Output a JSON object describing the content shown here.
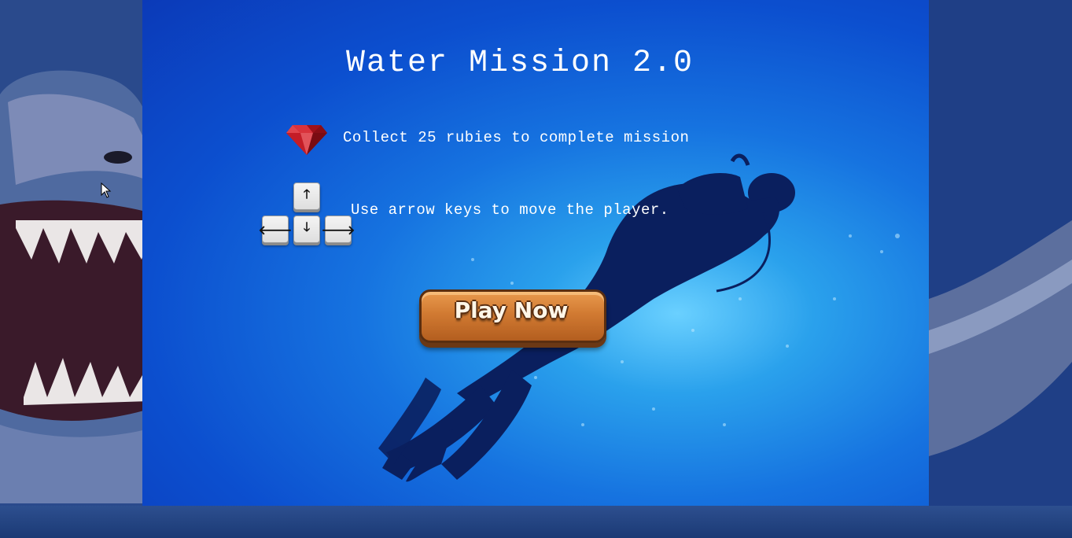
{
  "game": {
    "title": "Water Mission 2.0",
    "objective_text": "Collect 25 rubies to complete mission",
    "controls_text": "Use arrow keys to move the player.",
    "play_button_label": "Play Now"
  },
  "icons": {
    "objective": "ruby-icon",
    "keys": [
      "arrow-up-key",
      "arrow-left-key",
      "arrow-down-key",
      "arrow-right-key"
    ]
  },
  "key_glyphs": {
    "up": "🡑",
    "left": "🡐",
    "down": "🡓",
    "right": "🡒"
  },
  "colors": {
    "panel_blue": "#0c4fcf",
    "light_water": "#6ad0ff",
    "ruby": "#c0202a",
    "button_wood": "#d17a32",
    "text": "#ffffff"
  }
}
